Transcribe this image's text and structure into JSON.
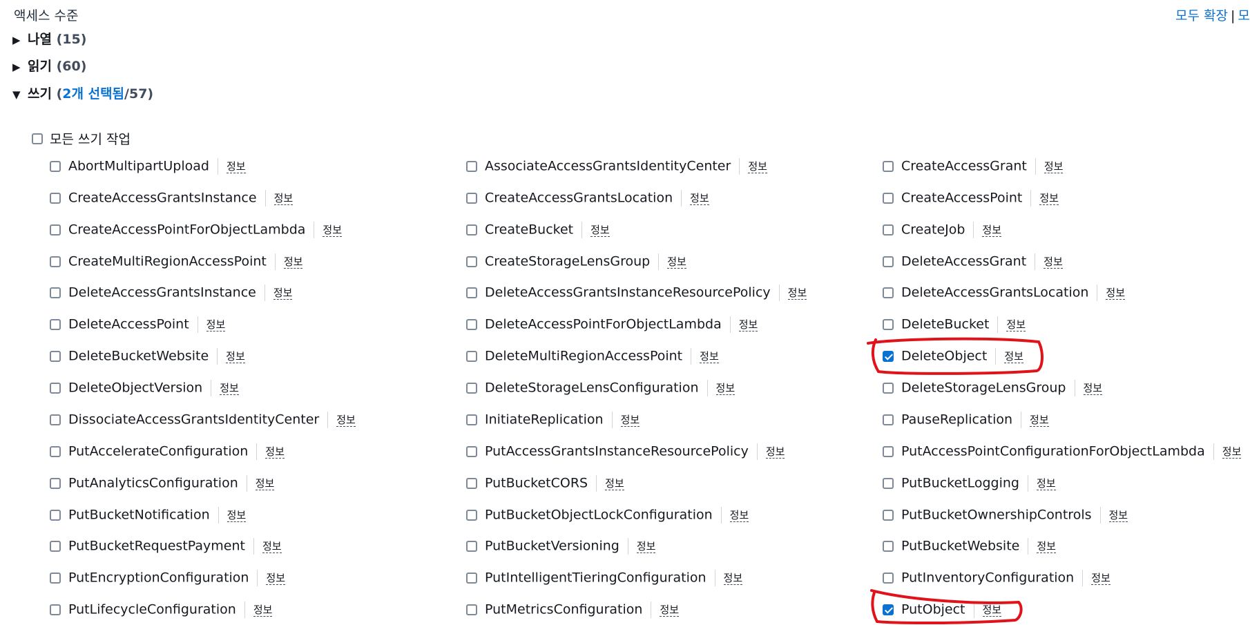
{
  "header": {
    "title": "액세스 수준",
    "expand_all": "모두 확장",
    "separator": "|",
    "collapse_all_partial": "모"
  },
  "sections": {
    "list": {
      "label": "나열",
      "count": "(15)"
    },
    "read": {
      "label": "읽기",
      "count": "(60)"
    },
    "write": {
      "label": "쓰기",
      "open_paren": "(",
      "selected": "2개 선택됨",
      "total": "/57)"
    }
  },
  "all_write": {
    "label": "모든 쓰기 작업",
    "checked": false
  },
  "info_label": "정보",
  "columns": [
    [
      {
        "name": "AbortMultipartUpload",
        "checked": false
      },
      {
        "name": "CreateAccessGrantsInstance",
        "checked": false
      },
      {
        "name": "CreateAccessPointForObjectLambda",
        "checked": false
      },
      {
        "name": "CreateMultiRegionAccessPoint",
        "checked": false
      },
      {
        "name": "DeleteAccessGrantsInstance",
        "checked": false
      },
      {
        "name": "DeleteAccessPoint",
        "checked": false
      },
      {
        "name": "DeleteBucketWebsite",
        "checked": false
      },
      {
        "name": "DeleteObjectVersion",
        "checked": false
      },
      {
        "name": "DissociateAccessGrantsIdentityCenter",
        "checked": false
      },
      {
        "name": "PutAccelerateConfiguration",
        "checked": false
      },
      {
        "name": "PutAnalyticsConfiguration",
        "checked": false
      },
      {
        "name": "PutBucketNotification",
        "checked": false
      },
      {
        "name": "PutBucketRequestPayment",
        "checked": false
      },
      {
        "name": "PutEncryptionConfiguration",
        "checked": false
      },
      {
        "name": "PutLifecycleConfiguration",
        "checked": false
      }
    ],
    [
      {
        "name": "AssociateAccessGrantsIdentityCenter",
        "checked": false
      },
      {
        "name": "CreateAccessGrantsLocation",
        "checked": false
      },
      {
        "name": "CreateBucket",
        "checked": false
      },
      {
        "name": "CreateStorageLensGroup",
        "checked": false
      },
      {
        "name": "DeleteAccessGrantsInstanceResourcePolicy",
        "checked": false
      },
      {
        "name": "DeleteAccessPointForObjectLambda",
        "checked": false
      },
      {
        "name": "DeleteMultiRegionAccessPoint",
        "checked": false
      },
      {
        "name": "DeleteStorageLensConfiguration",
        "checked": false
      },
      {
        "name": "InitiateReplication",
        "checked": false
      },
      {
        "name": "PutAccessGrantsInstanceResourcePolicy",
        "checked": false
      },
      {
        "name": "PutBucketCORS",
        "checked": false
      },
      {
        "name": "PutBucketObjectLockConfiguration",
        "checked": false
      },
      {
        "name": "PutBucketVersioning",
        "checked": false
      },
      {
        "name": "PutIntelligentTieringConfiguration",
        "checked": false
      },
      {
        "name": "PutMetricsConfiguration",
        "checked": false
      }
    ],
    [
      {
        "name": "CreateAccessGrant",
        "checked": false
      },
      {
        "name": "CreateAccessPoint",
        "checked": false
      },
      {
        "name": "CreateJob",
        "checked": false
      },
      {
        "name": "DeleteAccessGrant",
        "checked": false
      },
      {
        "name": "DeleteAccessGrantsLocation",
        "checked": false
      },
      {
        "name": "DeleteBucket",
        "checked": false
      },
      {
        "name": "DeleteObject",
        "checked": true
      },
      {
        "name": "DeleteStorageLensGroup",
        "checked": false
      },
      {
        "name": "PauseReplication",
        "checked": false
      },
      {
        "name": "PutAccessPointConfigurationForObjectLambda",
        "checked": false
      },
      {
        "name": "PutBucketLogging",
        "checked": false
      },
      {
        "name": "PutBucketOwnershipControls",
        "checked": false
      },
      {
        "name": "PutBucketWebsite",
        "checked": false
      },
      {
        "name": "PutInventoryConfiguration",
        "checked": false
      },
      {
        "name": "PutObject",
        "checked": true
      }
    ]
  ],
  "colors": {
    "accent": "#0972d3",
    "annotation": "#e0131a"
  }
}
